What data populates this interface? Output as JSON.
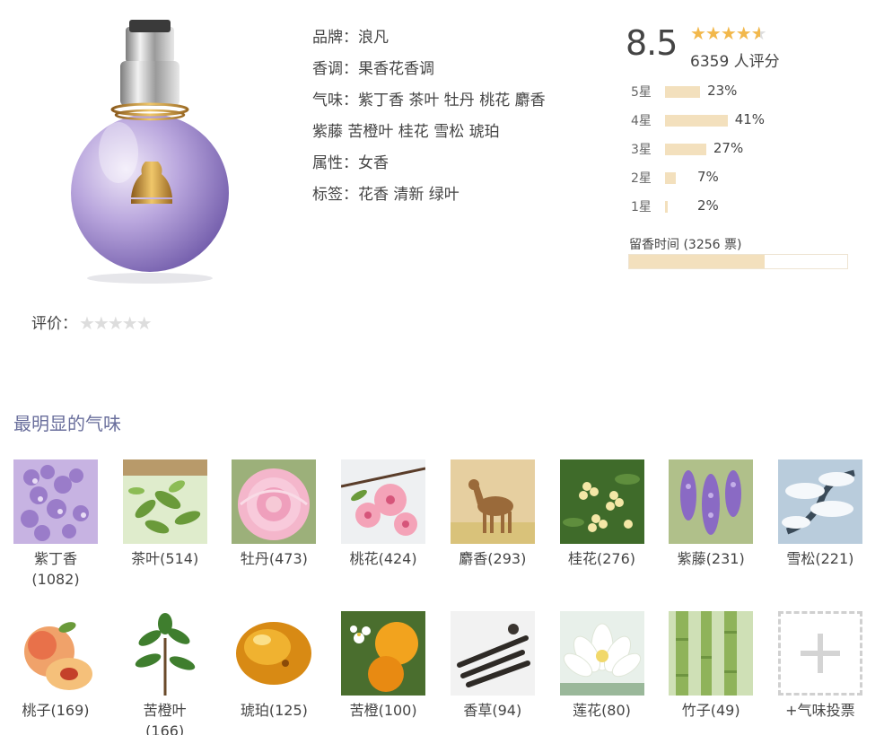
{
  "product": {
    "image_icon": "perfume-bottle-icon",
    "info": [
      {
        "label": "品牌：",
        "value": "浪凡"
      },
      {
        "label": "香调：",
        "value": "果香花香调"
      },
      {
        "label": "气味：",
        "value": "紫丁香 茶叶 牡丹 桃花 麝香"
      },
      {
        "label": "",
        "value": "紫藤 苦橙叶 桂花 雪松 琥珀"
      },
      {
        "label": "属性：",
        "value": "女香"
      },
      {
        "label": "标签：",
        "value": "花香 清新 绿叶"
      }
    ]
  },
  "rating": {
    "score": "8.5",
    "stars_value": 4.5,
    "star_color": "#f2b84b",
    "votes_text": "6359 人评分",
    "distribution": [
      {
        "label": "5星",
        "percent": 23,
        "text": "23%"
      },
      {
        "label": "4星",
        "percent": 41,
        "text": "41%"
      },
      {
        "label": "3星",
        "percent": 27,
        "text": "27%"
      },
      {
        "label": "2星",
        "percent": 7,
        "text": "7%"
      },
      {
        "label": "1星",
        "percent": 2,
        "text": "2%"
      }
    ],
    "bar_color": "#f3e0bd",
    "longevity_label": "留香时间 (3256 票)",
    "longevity_fraction": 0.62
  },
  "user_rating": {
    "label": "评价：",
    "stars": "★★★★★",
    "value": 0
  },
  "notes_section": {
    "title": "最明显的气味",
    "title_color": "#6a6f9c",
    "notes": [
      {
        "name": "紫丁香(1082)",
        "icon": "lilac-icon"
      },
      {
        "name": "茶叶(514)",
        "icon": "tea-leaf-icon"
      },
      {
        "name": "牡丹(473)",
        "icon": "peony-icon"
      },
      {
        "name": "桃花(424)",
        "icon": "peach-blossom-icon"
      },
      {
        "name": "麝香(293)",
        "icon": "musk-deer-icon"
      },
      {
        "name": "桂花(276)",
        "icon": "osmanthus-icon"
      },
      {
        "name": "紫藤(231)",
        "icon": "wisteria-icon"
      },
      {
        "name": "雪松(221)",
        "icon": "cedar-icon"
      },
      {
        "name": "桃子(169)",
        "icon": "peach-icon"
      },
      {
        "name": "苦橙叶(166)",
        "icon": "petitgrain-icon"
      },
      {
        "name": "琥珀(125)",
        "icon": "amber-icon"
      },
      {
        "name": "苦橙(100)",
        "icon": "bitter-orange-icon"
      },
      {
        "name": "香草(94)",
        "icon": "vanilla-icon"
      },
      {
        "name": "莲花(80)",
        "icon": "lotus-icon"
      },
      {
        "name": "竹子(49)",
        "icon": "bamboo-icon"
      }
    ],
    "vote_label": "+气味投票"
  }
}
